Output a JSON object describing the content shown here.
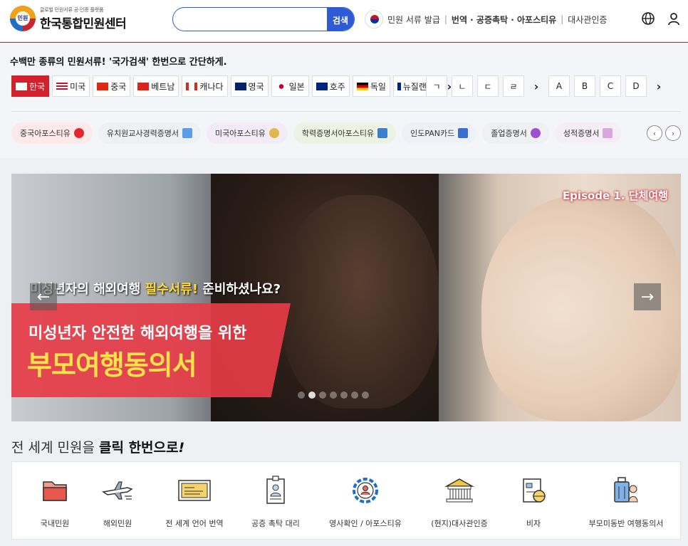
{
  "header": {
    "logo_small": "글로벌 민원서류 공·인증 플랫폼",
    "logo_title": "한국통합민원센터",
    "logo_badge": "민원",
    "search_placeholder": "",
    "search_button": "검색",
    "nav": [
      "민원 서류 발급",
      "번역 · 공증촉탁 · 아포스티유",
      "대사관인증"
    ]
  },
  "tagline": "수백만 종류의 민원서류! '국가검색' 한번으로 간단하게.",
  "countries": [
    {
      "label": "한국",
      "active": true
    },
    {
      "label": "미국",
      "active": false
    },
    {
      "label": "중국",
      "active": false
    },
    {
      "label": "베트남",
      "active": false
    },
    {
      "label": "캐나다",
      "active": false
    },
    {
      "label": "영국",
      "active": false
    },
    {
      "label": "일본",
      "active": false
    },
    {
      "label": "호주",
      "active": false
    },
    {
      "label": "독일",
      "active": false
    },
    {
      "label": "뉴질랜드",
      "active": false
    }
  ],
  "alphabet": [
    "ㄱ",
    "ㄴ",
    "ㄷ",
    "ㄹ",
    "A",
    "B",
    "C",
    "D"
  ],
  "chips": [
    {
      "label": "중국아포스티유",
      "color": "#fde9ea",
      "icon": "#e3262e"
    },
    {
      "label": "유치원교사경력증명서",
      "color": "#eef0f4",
      "icon": "#5b9de8"
    },
    {
      "label": "미국아포스티유",
      "color": "#f3ecf8",
      "icon": "#e1b84a"
    },
    {
      "label": "학력증명서아포스티유",
      "color": "#edf3e2",
      "icon": "#3a7fd0"
    },
    {
      "label": "인도PAN카드",
      "color": "#eef2f7",
      "icon": "#3a6ed0"
    },
    {
      "label": "졸업증명서",
      "color": "#eef0f4",
      "icon": "#9b4fd1"
    },
    {
      "label": "성적증명서",
      "color": "#f5eef6",
      "icon": "#d9a6e0"
    }
  ],
  "banner": {
    "episode": "Episode 1. 단체여행",
    "line1_a": "미성년자의 해외여행 ",
    "line1_b": "필수서류!",
    "line1_c": " 준비하셨나요?",
    "line2": "미성년자 안전한 해외여행을 위한",
    "line3": "부모여행동의서",
    "dots": 7,
    "active_dot": 1
  },
  "services_title_a": "전 세계 민원을 ",
  "services_title_b": "클릭 한번으로",
  "services_title_c": "!",
  "services": [
    {
      "label": "국내민원",
      "icon": "folder-icon"
    },
    {
      "label": "해외민원",
      "icon": "airplane-icon"
    },
    {
      "label": "전 세계 언어 번역",
      "icon": "translate-icon"
    },
    {
      "label": "공증 촉탁 대리",
      "icon": "id-badge-icon"
    },
    {
      "label": "영사확인 / 아포스티유",
      "icon": "gear-person-icon"
    },
    {
      "label": "(현지)대사관인증",
      "icon": "embassy-icon"
    },
    {
      "label": "비자",
      "icon": "visa-icon"
    },
    {
      "label": "부모미동반 여행동의서",
      "icon": "luggage-icon"
    }
  ]
}
